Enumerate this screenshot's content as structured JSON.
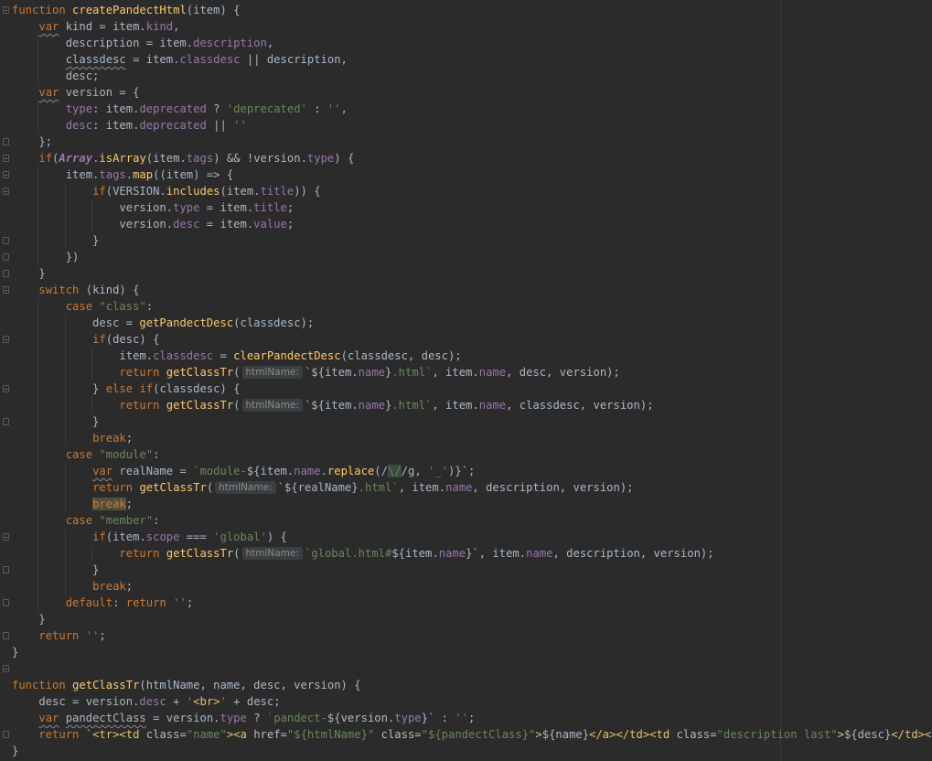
{
  "editor": {
    "hint_label": "htmlName:",
    "colors": {
      "background": "#2b2b2b",
      "keyword": "#cc7832",
      "function": "#ffc66d",
      "property": "#9876aa",
      "string": "#6a8759",
      "default_text": "#a9b7c6"
    },
    "lines": [
      [
        {
          "t": "function",
          "c": "kw"
        },
        {
          "t": " "
        },
        {
          "t": "createPandectHtml",
          "c": "fn"
        },
        {
          "t": "(item) {"
        }
      ],
      [
        {
          "t": "    "
        },
        {
          "t": "var",
          "c": "kw squig"
        },
        {
          "t": " kind = item."
        },
        {
          "t": "kind",
          "c": "prop"
        },
        {
          "t": ","
        }
      ],
      [
        {
          "t": "        description = item."
        },
        {
          "t": "description",
          "c": "prop"
        },
        {
          "t": ","
        }
      ],
      [
        {
          "t": "        "
        },
        {
          "t": "classdesc",
          "c": "squig"
        },
        {
          "t": " = item."
        },
        {
          "t": "classdesc",
          "c": "prop"
        },
        {
          "t": " || description,"
        }
      ],
      [
        {
          "t": "        desc;"
        }
      ],
      [
        {
          "t": "    "
        },
        {
          "t": "var",
          "c": "kw squig"
        },
        {
          "t": " version = {"
        }
      ],
      [
        {
          "t": "        "
        },
        {
          "t": "type",
          "c": "prop"
        },
        {
          "t": ": item."
        },
        {
          "t": "deprecated",
          "c": "prop"
        },
        {
          "t": " ? "
        },
        {
          "t": "'deprecated'",
          "c": "str"
        },
        {
          "t": " : "
        },
        {
          "t": "''",
          "c": "str"
        },
        {
          "t": ","
        }
      ],
      [
        {
          "t": "        "
        },
        {
          "t": "desc",
          "c": "prop"
        },
        {
          "t": ": item."
        },
        {
          "t": "deprecated",
          "c": "prop"
        },
        {
          "t": " || "
        },
        {
          "t": "''",
          "c": "str"
        }
      ],
      [
        {
          "t": "    };"
        }
      ],
      [
        {
          "t": "    "
        },
        {
          "t": "if",
          "c": "kw"
        },
        {
          "t": "("
        },
        {
          "t": "Array",
          "c": "cls"
        },
        {
          "t": "."
        },
        {
          "t": "isArray",
          "c": "fn"
        },
        {
          "t": "(item."
        },
        {
          "t": "tags",
          "c": "prop"
        },
        {
          "t": ") && !version."
        },
        {
          "t": "type",
          "c": "prop"
        },
        {
          "t": ") {"
        }
      ],
      [
        {
          "t": "        item."
        },
        {
          "t": "tags",
          "c": "prop"
        },
        {
          "t": "."
        },
        {
          "t": "map",
          "c": "fn"
        },
        {
          "t": "((item) => {"
        }
      ],
      [
        {
          "t": "            "
        },
        {
          "t": "if",
          "c": "kw"
        },
        {
          "t": "(VERSION."
        },
        {
          "t": "includes",
          "c": "fn"
        },
        {
          "t": "(item."
        },
        {
          "t": "title",
          "c": "prop"
        },
        {
          "t": ")) {"
        }
      ],
      [
        {
          "t": "                version."
        },
        {
          "t": "type",
          "c": "prop"
        },
        {
          "t": " = item."
        },
        {
          "t": "title",
          "c": "prop"
        },
        {
          "t": ";"
        }
      ],
      [
        {
          "t": "                version."
        },
        {
          "t": "desc",
          "c": "prop"
        },
        {
          "t": " = item."
        },
        {
          "t": "value",
          "c": "prop"
        },
        {
          "t": ";"
        }
      ],
      [
        {
          "t": "            }"
        }
      ],
      [
        {
          "t": "        })"
        }
      ],
      [
        {
          "t": "    }"
        }
      ],
      [
        {
          "t": "    "
        },
        {
          "t": "switch",
          "c": "kw"
        },
        {
          "t": " (kind) {"
        }
      ],
      [
        {
          "t": "        "
        },
        {
          "t": "case",
          "c": "kw"
        },
        {
          "t": " "
        },
        {
          "t": "\"class\"",
          "c": "str"
        },
        {
          "t": ":"
        }
      ],
      [
        {
          "t": "            desc = "
        },
        {
          "t": "getPandectDesc",
          "c": "fn"
        },
        {
          "t": "(classdesc);"
        }
      ],
      [
        {
          "t": "            "
        },
        {
          "t": "if",
          "c": "kw"
        },
        {
          "t": "(desc) {"
        }
      ],
      [
        {
          "t": "                item."
        },
        {
          "t": "classdesc",
          "c": "prop"
        },
        {
          "t": " = "
        },
        {
          "t": "clearPandectDesc",
          "c": "fn"
        },
        {
          "t": "(classdesc, desc);"
        }
      ],
      [
        {
          "t": "                "
        },
        {
          "t": "return",
          "c": "kw"
        },
        {
          "t": " "
        },
        {
          "t": "getClassTr",
          "c": "fn"
        },
        {
          "t": "("
        },
        {
          "h": true
        },
        {
          "t": "`${item."
        },
        {
          "t": "name",
          "c": "prop"
        },
        {
          "t": "}"
        },
        {
          "t": ".html`",
          "c": "str"
        },
        {
          "t": ", item."
        },
        {
          "t": "name",
          "c": "prop"
        },
        {
          "t": ", desc, version);"
        }
      ],
      [
        {
          "t": "            } "
        },
        {
          "t": "else",
          "c": "kw"
        },
        {
          "t": " "
        },
        {
          "t": "if",
          "c": "kw"
        },
        {
          "t": "(classdesc) {"
        }
      ],
      [
        {
          "t": "                "
        },
        {
          "t": "return",
          "c": "kw"
        },
        {
          "t": " "
        },
        {
          "t": "getClassTr",
          "c": "fn"
        },
        {
          "t": "("
        },
        {
          "h": true
        },
        {
          "t": "`${item."
        },
        {
          "t": "name",
          "c": "prop"
        },
        {
          "t": "}"
        },
        {
          "t": ".html`",
          "c": "str"
        },
        {
          "t": ", item."
        },
        {
          "t": "name",
          "c": "prop"
        },
        {
          "t": ", classdesc, version);"
        }
      ],
      [
        {
          "t": "            }"
        }
      ],
      [
        {
          "t": "            "
        },
        {
          "t": "break",
          "c": "kw"
        },
        {
          "t": ";"
        }
      ],
      [
        {
          "t": "        "
        },
        {
          "t": "case",
          "c": "kw"
        },
        {
          "t": " "
        },
        {
          "t": "\"module\"",
          "c": "str"
        },
        {
          "t": ":"
        }
      ],
      [
        {
          "t": "            "
        },
        {
          "t": "var",
          "c": "kw squig"
        },
        {
          "t": " realName = "
        },
        {
          "t": "`module-",
          "c": "str"
        },
        {
          "t": "${item."
        },
        {
          "t": "name",
          "c": "prop"
        },
        {
          "t": "."
        },
        {
          "t": "replace",
          "c": "fn"
        },
        {
          "t": "(/"
        },
        {
          "t": "\\/",
          "c": "str hl"
        },
        {
          "t": "/g, "
        },
        {
          "t": "'_'",
          "c": "str"
        },
        {
          "t": ")}`;"
        }
      ],
      [
        {
          "t": "            "
        },
        {
          "t": "return",
          "c": "kw"
        },
        {
          "t": " "
        },
        {
          "t": "getClassTr",
          "c": "fn"
        },
        {
          "t": "("
        },
        {
          "h": true
        },
        {
          "t": "`${realName}"
        },
        {
          "t": ".html`",
          "c": "str"
        },
        {
          "t": ", item."
        },
        {
          "t": "name",
          "c": "prop"
        },
        {
          "t": ", description, version);"
        }
      ],
      [
        {
          "t": "            "
        },
        {
          "t": "break",
          "c": "kw hlbreak"
        },
        {
          "t": ";"
        }
      ],
      [
        {
          "t": "        "
        },
        {
          "t": "case",
          "c": "kw"
        },
        {
          "t": " "
        },
        {
          "t": "\"member\"",
          "c": "str"
        },
        {
          "t": ":"
        }
      ],
      [
        {
          "t": "            "
        },
        {
          "t": "if",
          "c": "kw"
        },
        {
          "t": "(item."
        },
        {
          "t": "scope",
          "c": "prop"
        },
        {
          "t": " === "
        },
        {
          "t": "'global'",
          "c": "str"
        },
        {
          "t": ") {"
        }
      ],
      [
        {
          "t": "                "
        },
        {
          "t": "return",
          "c": "kw"
        },
        {
          "t": " "
        },
        {
          "t": "getClassTr",
          "c": "fn"
        },
        {
          "t": "("
        },
        {
          "h": true
        },
        {
          "t": "`global.html#",
          "c": "str"
        },
        {
          "t": "${item."
        },
        {
          "t": "name",
          "c": "prop"
        },
        {
          "t": "}`"
        },
        {
          "t": ", item."
        },
        {
          "t": "name",
          "c": "prop"
        },
        {
          "t": ", description, version);"
        }
      ],
      [
        {
          "t": "            }"
        }
      ],
      [
        {
          "t": "            "
        },
        {
          "t": "break",
          "c": "kw"
        },
        {
          "t": ";"
        }
      ],
      [
        {
          "t": "        "
        },
        {
          "t": "default",
          "c": "kw"
        },
        {
          "t": ": "
        },
        {
          "t": "return",
          "c": "kw"
        },
        {
          "t": " "
        },
        {
          "t": "''",
          "c": "str"
        },
        {
          "t": ";"
        }
      ],
      [
        {
          "t": "    }"
        }
      ],
      [
        {
          "t": "    "
        },
        {
          "t": "return",
          "c": "kw"
        },
        {
          "t": " "
        },
        {
          "t": "''",
          "c": "str"
        },
        {
          "t": ";"
        }
      ],
      [
        {
          "t": "}"
        }
      ],
      [
        {
          "t": ""
        }
      ],
      [
        {
          "t": "function",
          "c": "kw"
        },
        {
          "t": " "
        },
        {
          "t": "getClassTr",
          "c": "fn"
        },
        {
          "t": "(htmlName, name, desc, version) {"
        }
      ],
      [
        {
          "t": "    desc = version."
        },
        {
          "t": "desc",
          "c": "prop"
        },
        {
          "t": " + "
        },
        {
          "t": "'",
          "c": "str"
        },
        {
          "t": "<br>",
          "c": "tag"
        },
        {
          "t": "'",
          "c": "str"
        },
        {
          "t": " + desc;"
        }
      ],
      [
        {
          "t": "    "
        },
        {
          "t": "var",
          "c": "kw squig"
        },
        {
          "t": " "
        },
        {
          "t": "pandectClass",
          "c": "squig"
        },
        {
          "t": " = version."
        },
        {
          "t": "type",
          "c": "prop"
        },
        {
          "t": " ? "
        },
        {
          "t": "`pandect-",
          "c": "str"
        },
        {
          "t": "${version."
        },
        {
          "t": "type",
          "c": "prop"
        },
        {
          "t": "}`"
        },
        {
          "t": " : "
        },
        {
          "t": "''",
          "c": "str"
        },
        {
          "t": ";"
        }
      ],
      [
        {
          "t": "    "
        },
        {
          "t": "return",
          "c": "kw"
        },
        {
          "t": " `"
        },
        {
          "t": "<tr><td ",
          "c": "tag"
        },
        {
          "t": "class=",
          "c": "attr"
        },
        {
          "t": "\"name\"",
          "c": "str"
        },
        {
          "t": "><a ",
          "c": "tag"
        },
        {
          "t": "href=",
          "c": "attr"
        },
        {
          "t": "\"${htmlName}\"",
          "c": "str"
        },
        {
          "t": " class=",
          "c": "attr"
        },
        {
          "t": "\"${pandectClass}\"",
          "c": "str"
        },
        {
          "t": ">",
          "c": "tag"
        },
        {
          "t": "${name}"
        },
        {
          "t": "</a></td><td ",
          "c": "tag"
        },
        {
          "t": "class=",
          "c": "attr"
        },
        {
          "t": "\"description last\"",
          "c": "str"
        },
        {
          "t": ">",
          "c": "tag"
        },
        {
          "t": "${desc}"
        },
        {
          "t": "</td></tr>",
          "c": "tag"
        },
        {
          "t": "`"
        }
      ],
      [
        {
          "t": "}"
        }
      ]
    ]
  }
}
